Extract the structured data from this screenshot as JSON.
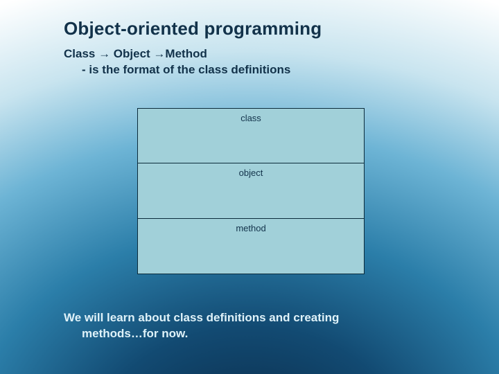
{
  "title": "Object-oriented programming",
  "subtitle": {
    "line1": "Class → Object →Method",
    "line2": "- is the format of the class definitions"
  },
  "boxes": {
    "row1": "class",
    "row2": "object",
    "row3": "method"
  },
  "footer": {
    "line1": "We will learn about class definitions and creating",
    "line2": "methods…for now."
  }
}
